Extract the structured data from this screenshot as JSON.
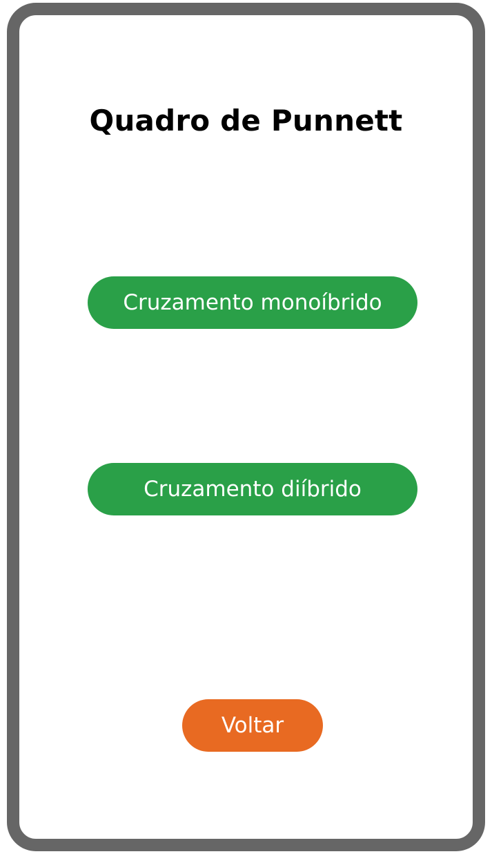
{
  "screen": {
    "title": "Quadro de Punnett"
  },
  "buttons": {
    "monohybrid_label": "Cruzamento monoíbrido",
    "dihybrid_label": "Cruzamento diíbrido",
    "back_label": "Voltar"
  },
  "colors": {
    "frame": "#666666",
    "primary_button": "#2aa048",
    "back_button": "#e86a22",
    "background": "#ffffff",
    "button_text": "#ffffff"
  }
}
